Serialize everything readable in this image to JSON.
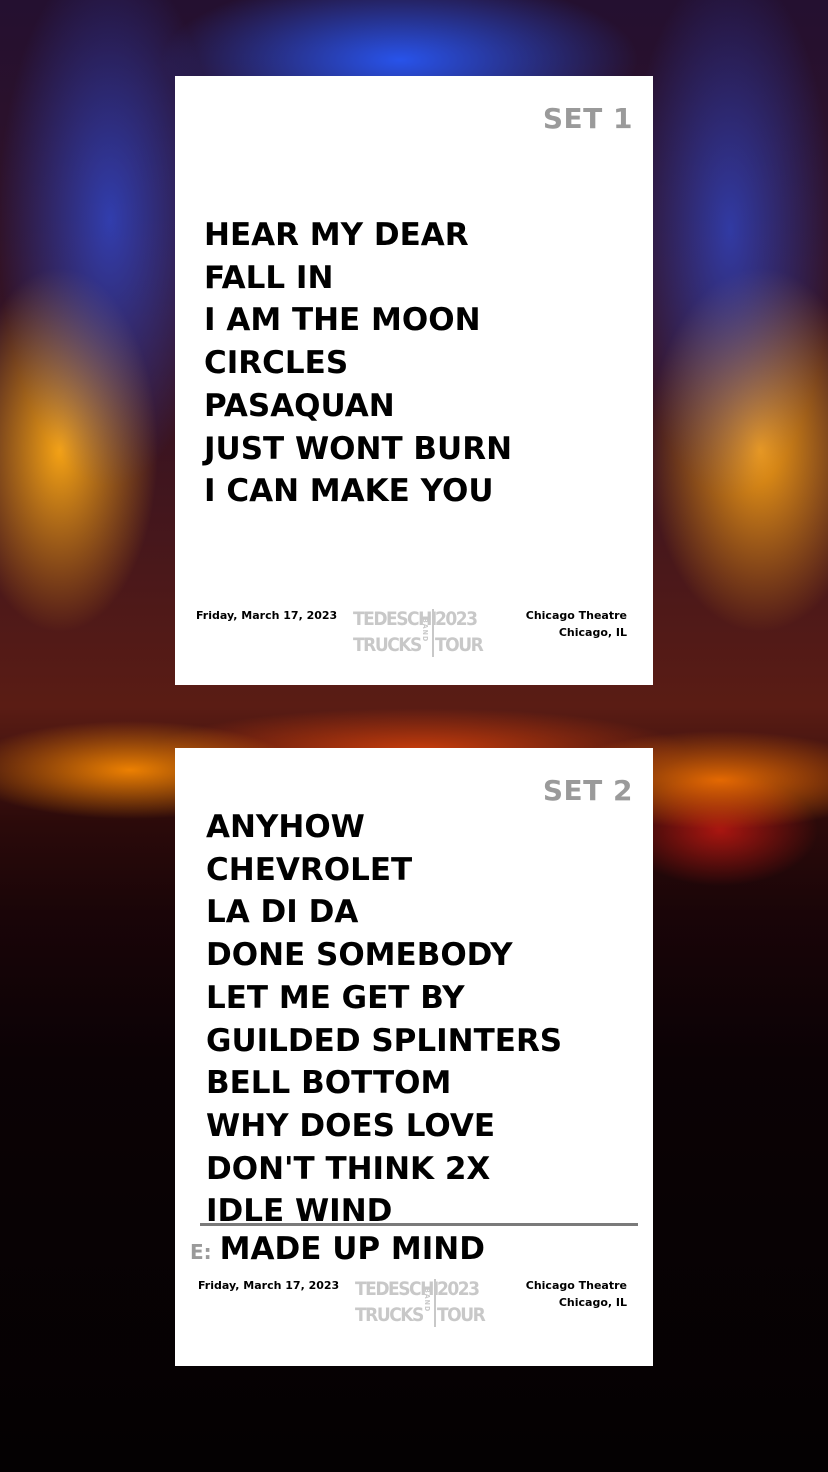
{
  "setlists": [
    {
      "label": "SET 1",
      "songs": [
        "HEAR MY DEAR",
        "FALL IN",
        "I AM THE MOON",
        "CIRCLES",
        "PASAQUAN",
        "JUST WONT BURN",
        "I CAN MAKE YOU"
      ],
      "date": "Friday, March 17, 2023",
      "venue": "Chicago Theatre",
      "city": "Chicago, IL"
    },
    {
      "label": "SET 2",
      "songs": [
        "ANYHOW",
        "CHEVROLET",
        "LA DI DA",
        "DONE SOMEBODY",
        "LET ME GET BY",
        "GUILDED SPLINTERS",
        "BELL BOTTOM",
        "WHY DOES LOVE",
        "DON'T THINK 2X",
        "IDLE WIND"
      ],
      "encore_marker": "E:",
      "encore": "MADE UP MIND",
      "date": "Friday, March 17, 2023",
      "venue": "Chicago Theatre",
      "city": "Chicago, IL"
    }
  ],
  "logo": {
    "line1": "TEDESCHI",
    "line2": "TRUCKS",
    "band": "BAND",
    "year": "2023",
    "tour": "TOUR"
  }
}
